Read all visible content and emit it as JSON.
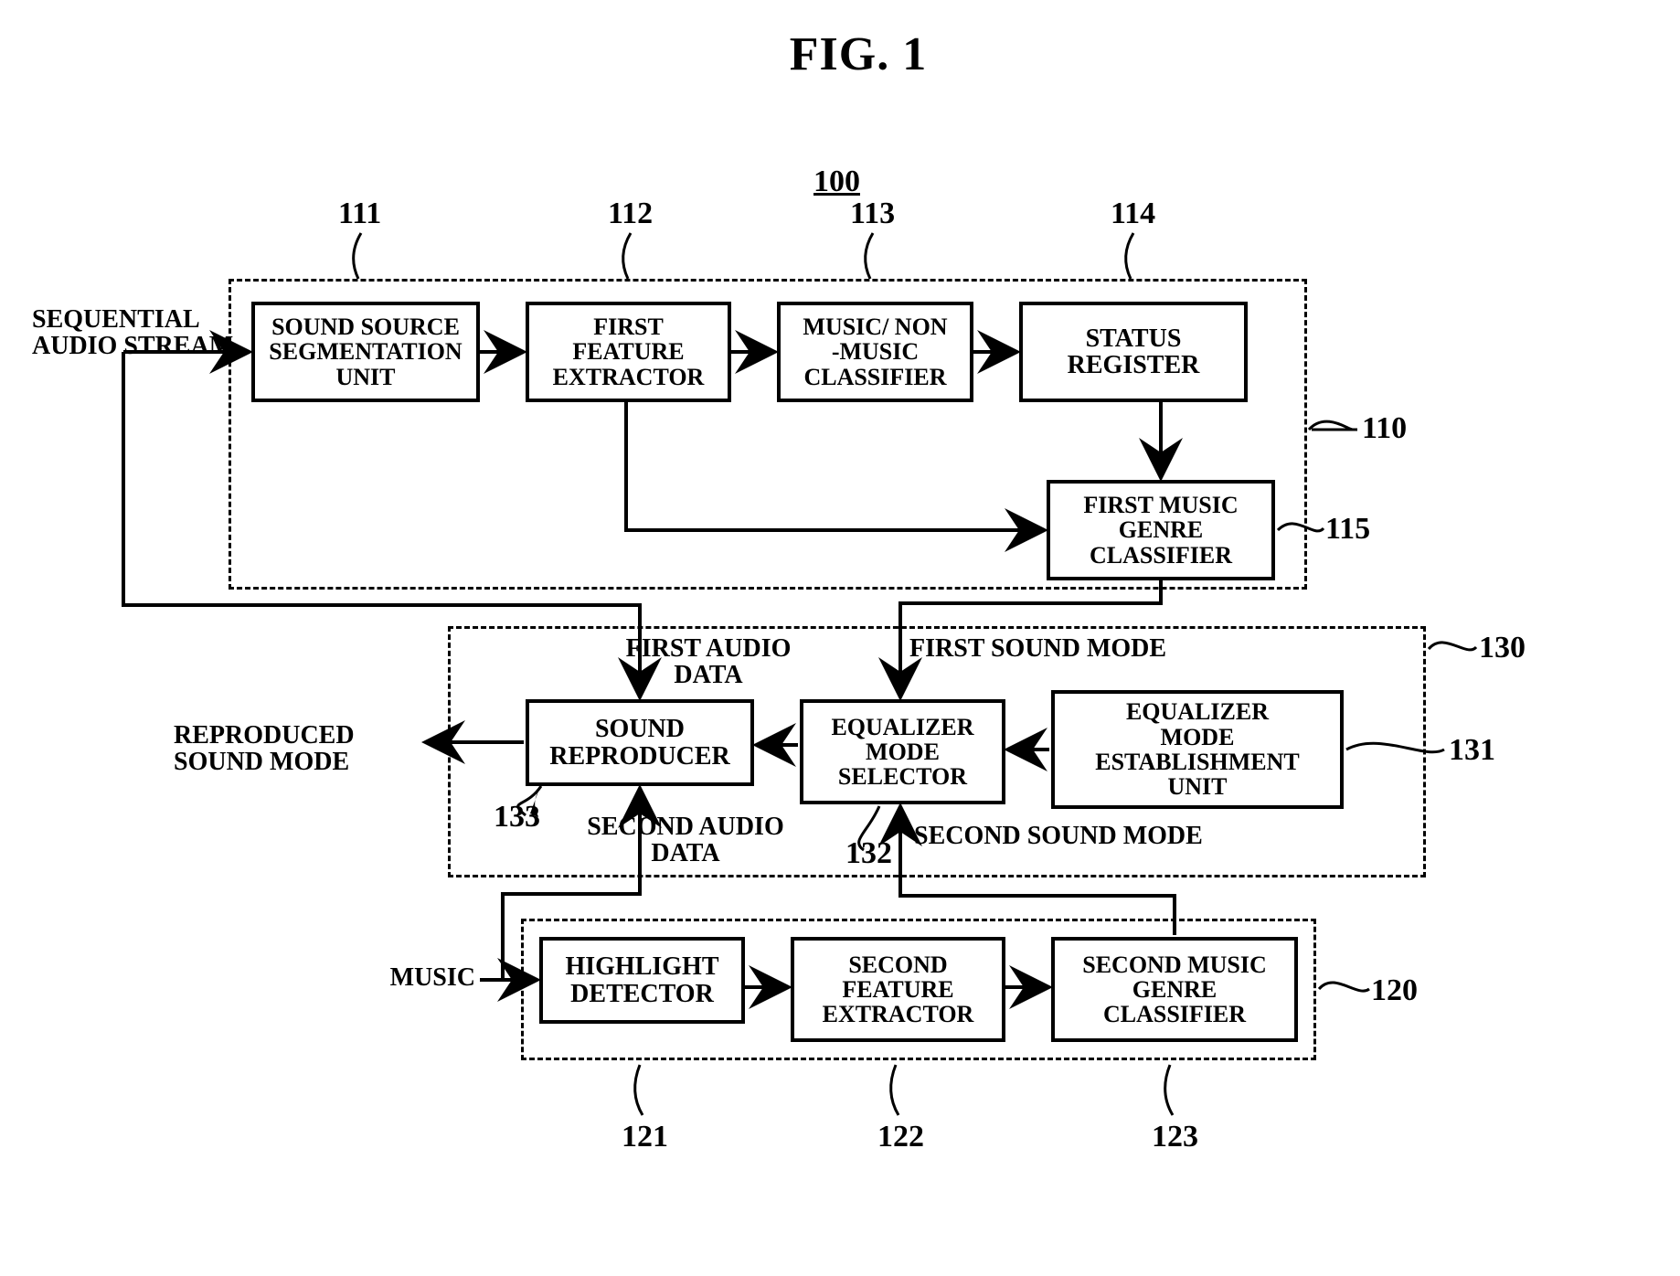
{
  "title": "FIG. 1",
  "system_ref": "100",
  "refs": {
    "r111": "111",
    "r112": "112",
    "r113": "113",
    "r114": "114",
    "r110": "110",
    "r115": "115",
    "r130": "130",
    "r131": "131",
    "r132": "132",
    "r133": "133",
    "r120": "120",
    "r121": "121",
    "r122": "122",
    "r123": "123"
  },
  "io": {
    "seq_audio": "SEQUENTIAL\nAUDIO STREAM",
    "reproduced": "REPRODUCED\nSOUND MODE",
    "music": "MUSIC"
  },
  "signals": {
    "first_audio": "FIRST AUDIO\nDATA",
    "first_sound": "FIRST SOUND MODE",
    "second_audio": "SECOND AUDIO\nDATA",
    "second_sound": "SECOND SOUND MODE"
  },
  "blocks": {
    "b111": "SOUND SOURCE\nSEGMENTATION\nUNIT",
    "b112": "FIRST\nFEATURE\nEXTRACTOR",
    "b113": "MUSIC/ NON\n-MUSIC\nCLASSIFIER",
    "b114": "STATUS\nREGISTER",
    "b115": "FIRST MUSIC\nGENRE\nCLASSIFIER",
    "b131": "EQUALIZER\nMODE\nESTABLISHMENT\nUNIT",
    "b132": "EQUALIZER\nMODE\nSELECTOR",
    "b133": "SOUND\nREPRODUCER",
    "b121": "HIGHLIGHT\nDETECTOR",
    "b122": "SECOND\nFEATURE\nEXTRACTOR",
    "b123": "SECOND MUSIC\nGENRE\nCLASSIFIER"
  }
}
